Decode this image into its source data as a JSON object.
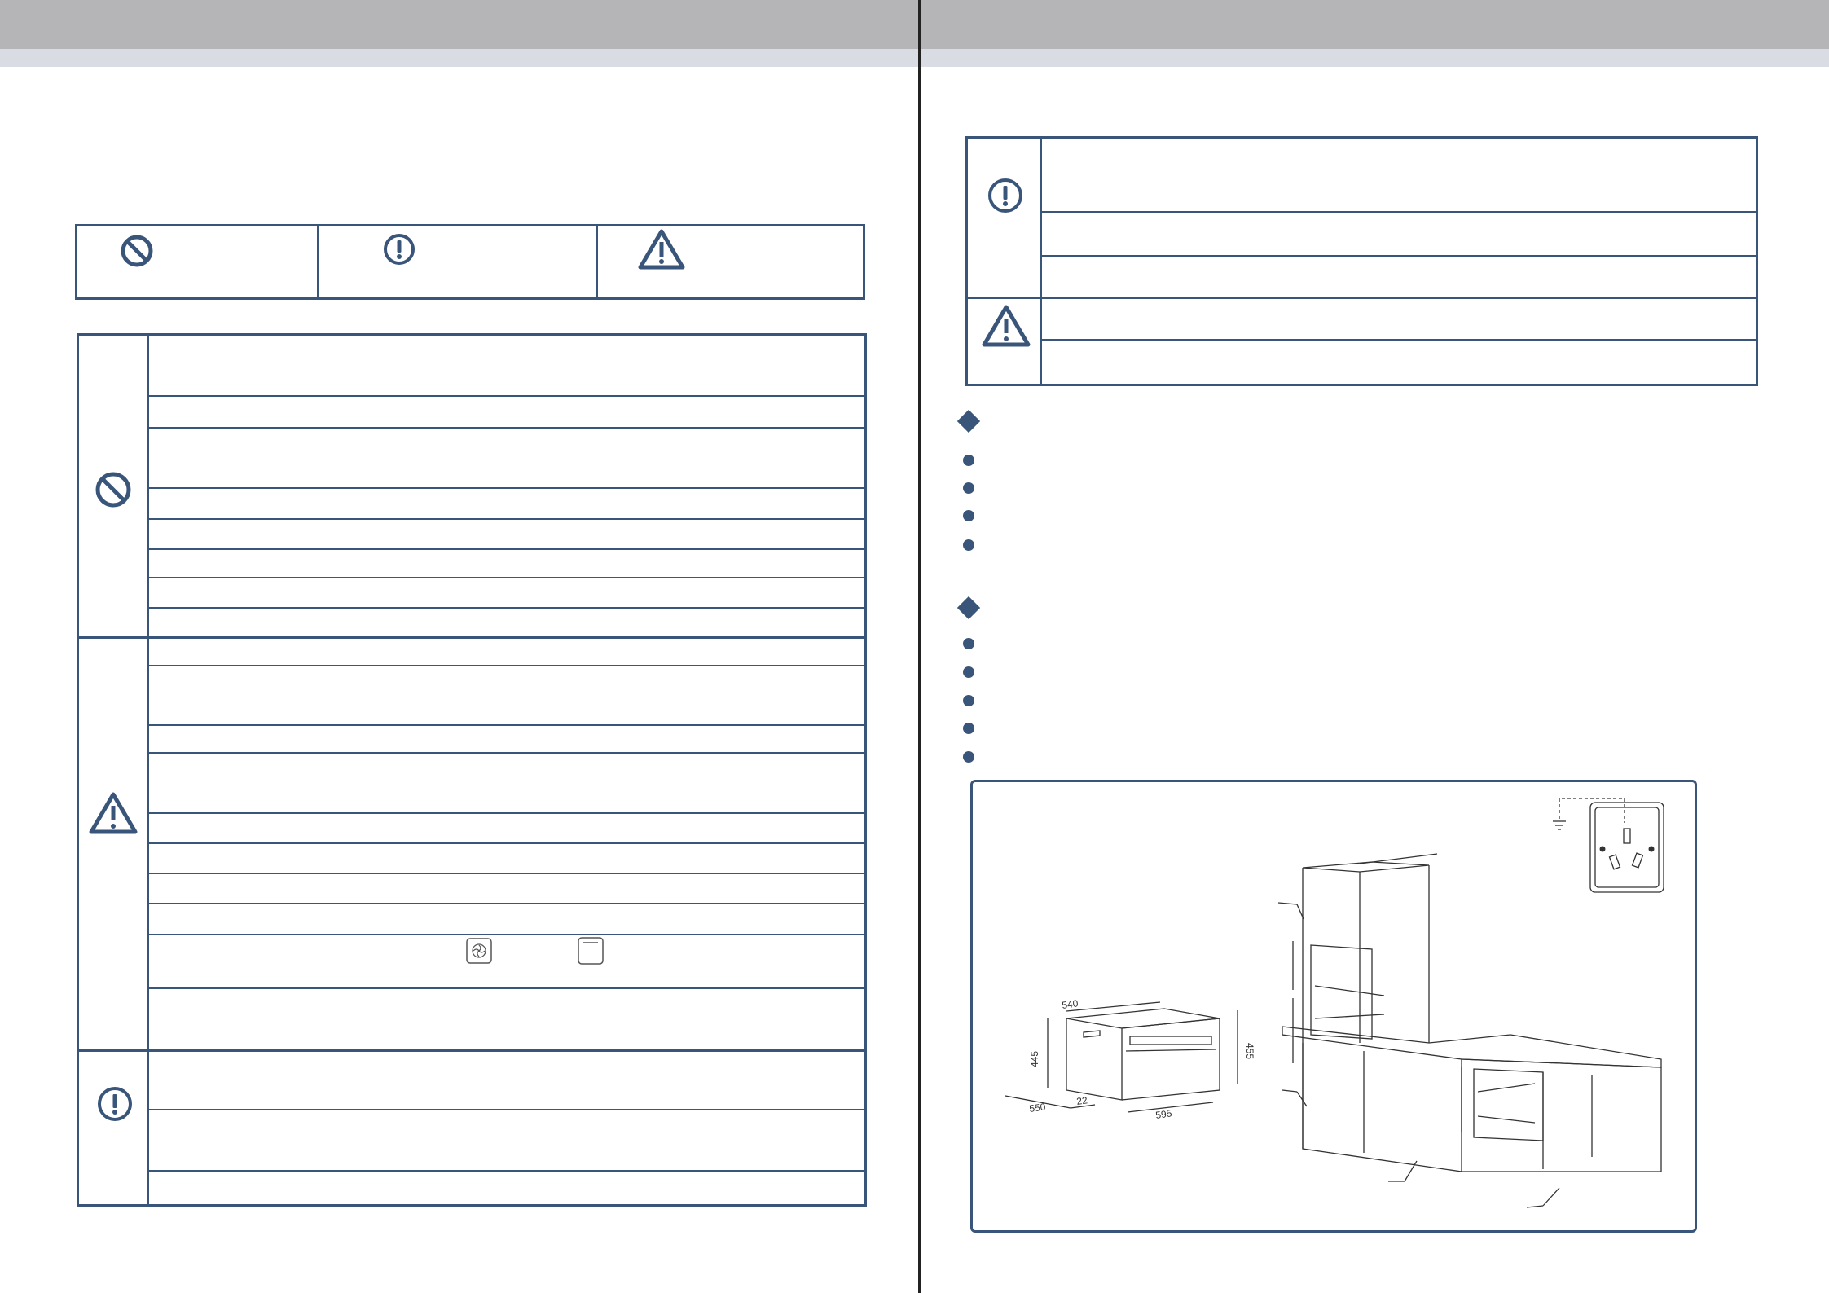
{
  "page": {
    "colors": {
      "accent": "#3a557a",
      "header_bar": "#b5b5b7",
      "sub_bar": "#d9dde3",
      "spine": "#222222"
    }
  },
  "legend": {
    "cells": [
      {
        "icon": "prohibited-icon"
      },
      {
        "icon": "mandatory-icon"
      },
      {
        "icon": "warning-triangle-icon"
      }
    ]
  },
  "left_table": {
    "groups": [
      {
        "icon": "prohibited-icon",
        "rows": 8
      },
      {
        "icon": "warning-triangle-icon",
        "rows": 10,
        "inline_icons": [
          "fan-mode-icon",
          "top-heat-mode-icon"
        ]
      },
      {
        "icon": "mandatory-icon",
        "rows": 3
      }
    ]
  },
  "right_table": {
    "groups": [
      {
        "icon": "mandatory-icon",
        "rows": 3
      },
      {
        "icon": "warning-triangle-icon",
        "rows": 2
      }
    ]
  },
  "sections": [
    {
      "marker": "diamond-icon",
      "bullets": 4
    },
    {
      "marker": "diamond-icon",
      "bullets": 5
    }
  ],
  "diagram": {
    "dimensions": {
      "depth": "540",
      "height": "445",
      "front_height": "455",
      "width": "595",
      "side": "550",
      "front_depth": "22"
    }
  }
}
